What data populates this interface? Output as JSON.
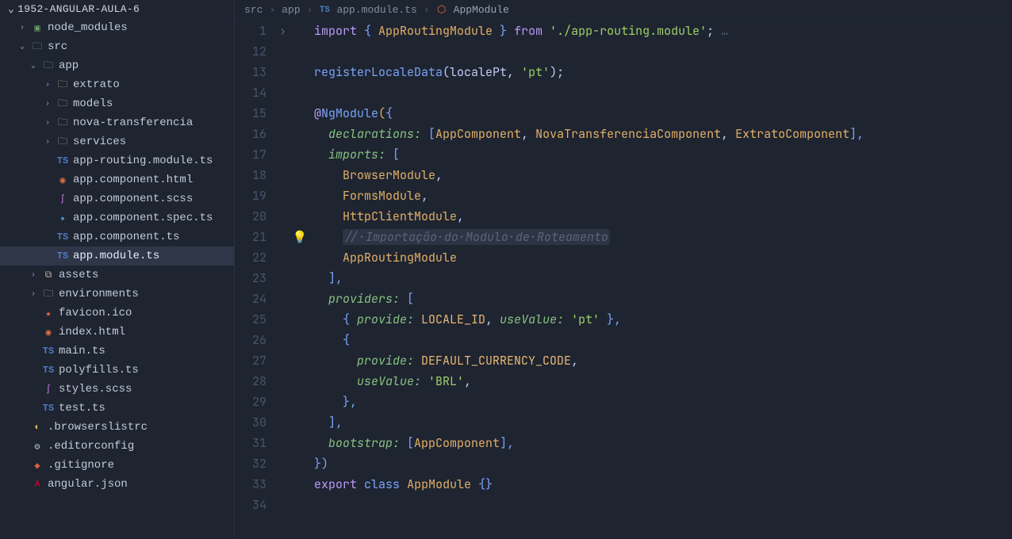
{
  "project_name": "1952-ANGULAR-AULA-6",
  "sidebar_tree": {
    "node_modules": "node_modules",
    "src": "src",
    "app": "app",
    "extrato": "extrato",
    "models": "models",
    "nova_transferencia": "nova-transferencia",
    "services": "services",
    "app_routing_module_ts": "app-routing.module.ts",
    "app_component_html": "app.component.html",
    "app_component_scss": "app.component.scss",
    "app_component_spec_ts": "app.component.spec.ts",
    "app_component_ts": "app.component.ts",
    "app_module_ts": "app.module.ts",
    "assets": "assets",
    "environments": "environments",
    "favicon_ico": "favicon.ico",
    "index_html": "index.html",
    "main_ts": "main.ts",
    "polyfills_ts": "polyfills.ts",
    "styles_scss": "styles.scss",
    "test_ts": "test.ts",
    "browserslistrc": ".browserslistrc",
    "editorconfig": ".editorconfig",
    "gitignore": ".gitignore",
    "angular_json": "angular.json"
  },
  "breadcrumbs": {
    "p1": "src",
    "p2": "app",
    "p3": "app.module.ts",
    "p4": "AppModule"
  },
  "line_numbers": [
    "1",
    "12",
    "13",
    "14",
    "15",
    "16",
    "17",
    "18",
    "19",
    "20",
    "21",
    "22",
    "23",
    "24",
    "25",
    "26",
    "27",
    "28",
    "29",
    "30",
    "31",
    "32",
    "33",
    "34"
  ],
  "code": {
    "l1_a": "import",
    "l1_b": " { ",
    "l1_c": "AppRoutingModule",
    "l1_d": " } ",
    "l1_e": "from",
    "l1_f": " ",
    "l1_g": "'./app-routing.module'",
    "l1_h": ";",
    "l1_i": " …",
    "l13_a": "registerLocaleData",
    "l13_b": "(",
    "l13_c": "localePt",
    "l13_d": ", ",
    "l13_e": "'pt'",
    "l13_f": ");",
    "l15_a": "@",
    "l15_b": "NgModule",
    "l15_c": "(",
    "l15_d": "{",
    "l16_a": "  ",
    "l16_b": "declarations:",
    "l16_c": " [",
    "l16_d": "AppComponent",
    "l16_e": ", ",
    "l16_f": "NovaTransferenciaComponent",
    "l16_g": ", ",
    "l16_h": "ExtratoComponent",
    "l16_i": "],",
    "l17_a": "  ",
    "l17_b": "imports:",
    "l17_c": " [",
    "l18_a": "    ",
    "l18_b": "BrowserModule",
    "l18_c": ",",
    "l19_a": "    ",
    "l19_b": "FormsModule",
    "l19_c": ",",
    "l20_a": "    ",
    "l20_b": "HttpClientModule",
    "l20_c": ",",
    "l21_a": "    ",
    "l21_b": "//·Importação·do·Modulo·de·Roteamento",
    "l22_a": "    ",
    "l22_b": "AppRoutingModule",
    "l23_a": "  ],",
    "l24_a": "  ",
    "l24_b": "providers:",
    "l24_c": " [",
    "l25_a": "    { ",
    "l25_b": "provide:",
    "l25_c": " ",
    "l25_d": "LOCALE_ID",
    "l25_e": ", ",
    "l25_f": "useValue:",
    "l25_g": " ",
    "l25_h": "'pt'",
    "l25_i": " },",
    "l26_a": "    {",
    "l27_a": "      ",
    "l27_b": "provide:",
    "l27_c": " ",
    "l27_d": "DEFAULT_CURRENCY_CODE",
    "l27_e": ",",
    "l28_a": "      ",
    "l28_b": "useValue:",
    "l28_c": " ",
    "l28_d": "'BRL'",
    "l28_e": ",",
    "l29_a": "    },",
    "l30_a": "  ],",
    "l31_a": "  ",
    "l31_b": "bootstrap:",
    "l31_c": " [",
    "l31_d": "AppComponent",
    "l31_e": "],",
    "l32_a": "})",
    "l33_a": "export",
    "l33_b": " ",
    "l33_c": "class",
    "l33_d": " ",
    "l33_e": "AppModule",
    "l33_f": " {}"
  }
}
